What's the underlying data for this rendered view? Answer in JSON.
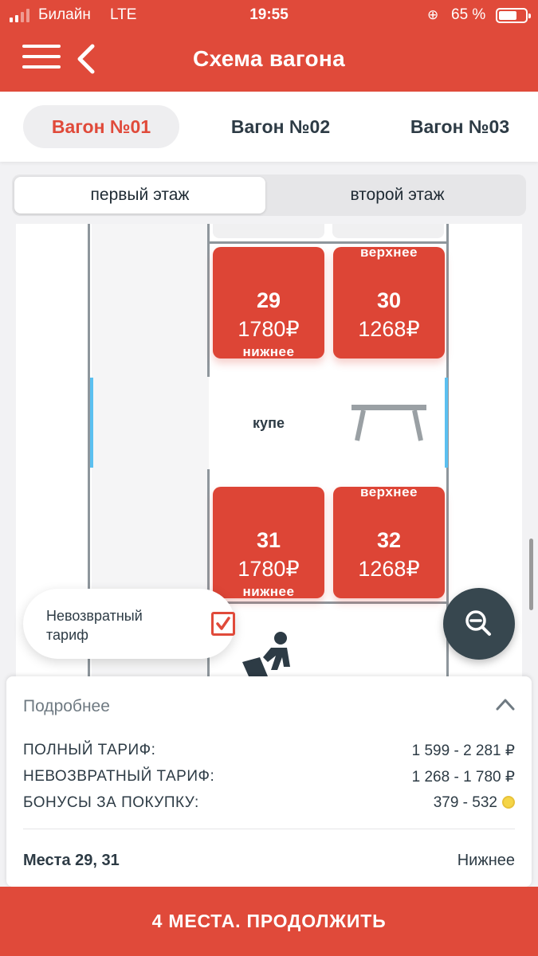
{
  "status_bar": {
    "carrier": "Билайн",
    "network": "LTE",
    "time": "19:55",
    "battery_percent": "65 %",
    "battery_level": 0.65
  },
  "header": {
    "title": "Схема вагона",
    "icons": {
      "menu": "hamburger-icon",
      "back": "chevron-left-icon"
    }
  },
  "wagons": [
    {
      "label": "Вагон №01",
      "active": true
    },
    {
      "label": "Вагон №02",
      "active": false
    },
    {
      "label": "Вагон №03",
      "active": false
    }
  ],
  "floors": [
    {
      "label": "первый этаж",
      "active": true
    },
    {
      "label": "второй этаж",
      "active": false
    }
  ],
  "scheme": {
    "compartment_label": "купе",
    "seats": [
      {
        "number": "29",
        "price": "1780₽",
        "position": "нижнее"
      },
      {
        "number": "30",
        "price": "1268₽",
        "position": "верхнее"
      },
      {
        "number": "31",
        "price": "1780₽",
        "position": "нижнее"
      },
      {
        "number": "32",
        "price": "1268₽",
        "position": "верхнее"
      }
    ],
    "icons": {
      "table": "table-icon",
      "service": "person-service-icon"
    }
  },
  "tariff_chip": {
    "label": "Невозвратный тариф",
    "checked": true
  },
  "zoom": {
    "icon": "zoom-out-icon"
  },
  "details": {
    "title": "Подробнее",
    "rows": [
      {
        "label": "ПОЛНЫЙ ТАРИФ:",
        "value": "1 599 - 2 281 ₽"
      },
      {
        "label": "НЕВОЗВРАТНЫЙ ТАРИФ:",
        "value": "1 268 - 1 780 ₽"
      },
      {
        "label": "БОНУСЫ ЗА ПОКУПКУ:",
        "value": "379 - 532"
      }
    ],
    "places": "Места 29, 31",
    "places_position": "Нижнее"
  },
  "continue_label": "4 МЕСТА. ПРОДОЛЖИТЬ",
  "colors": {
    "accent": "#e04a3a",
    "seat": "#dd4536",
    "dark": "#37474f",
    "window": "#5bc0f0"
  }
}
